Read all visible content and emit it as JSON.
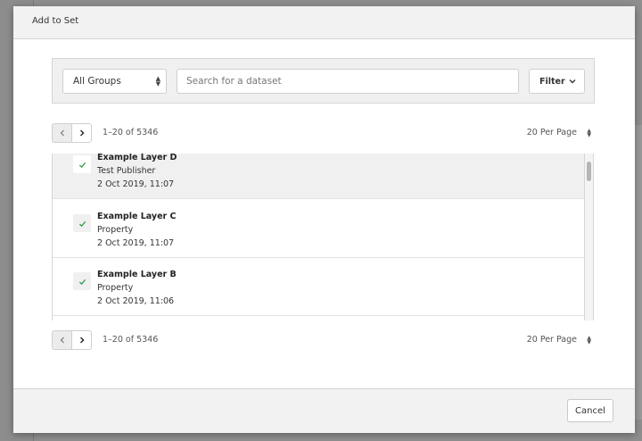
{
  "modal": {
    "title": "Add to Set",
    "cancel_label": "Cancel"
  },
  "search": {
    "group_selected": "All Groups",
    "placeholder": "Search for a dataset",
    "value": "",
    "filter_label": "Filter"
  },
  "pagination": {
    "range": "1–20 of 5346",
    "per_page": "20 Per Page"
  },
  "datasets": [
    {
      "name": "Example Layer D",
      "publisher": "Test Publisher",
      "date": "2 Oct 2019, 11:07",
      "checked": true,
      "selected": true
    },
    {
      "name": "Example Layer C",
      "publisher": "Property",
      "date": "2 Oct 2019, 11:07",
      "checked": true,
      "selected": false
    },
    {
      "name": "Example Layer B",
      "publisher": "Property",
      "date": "2 Oct 2019, 11:06",
      "checked": true,
      "selected": false
    }
  ],
  "colors": {
    "check": "#2e9a4a",
    "header_bg": "#f2f2f2",
    "selected_row": "#f0f0f0"
  },
  "icons": {
    "check": "check-icon",
    "prev": "chevron-left-icon",
    "next": "chevron-right-icon",
    "filter": "chevron-down-icon",
    "sort": "sort-arrows-icon"
  }
}
